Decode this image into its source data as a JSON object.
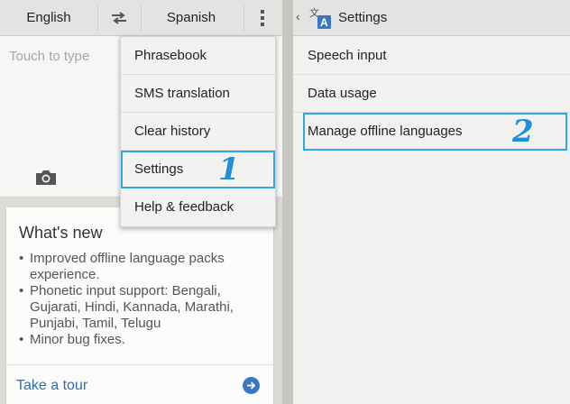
{
  "left": {
    "source_language": "English",
    "target_language": "Spanish",
    "input_placeholder": "Touch to type",
    "whats_new": {
      "title": "What's new",
      "items": [
        "Improved offline language packs experience.",
        "Phonetic input support: Bengali, Gujarati, Hindi, Kannada, Marathi, Punjabi, Tamil, Telugu",
        "Minor bug fixes."
      ],
      "tour_label": "Take a tour"
    }
  },
  "menu": {
    "items": [
      "Phrasebook",
      "SMS translation",
      "Clear history",
      "Settings",
      "Help & feedback"
    ],
    "step_marker": "1"
  },
  "right": {
    "back_glyph": "‹",
    "title": "Settings",
    "items": [
      "Speech input",
      "Data usage",
      "Manage offline languages"
    ],
    "step_marker": "2"
  },
  "colors": {
    "highlight": "#2fa8e0",
    "step_number": "#1e90d8",
    "link": "#2c6cb8",
    "app_icon": "#3b78c4"
  },
  "icons": [
    "swap-languages-icon",
    "overflow-menu-icon",
    "camera-icon",
    "arrow-right-circle-icon",
    "translate-app-icon",
    "back-chevron-icon"
  ]
}
